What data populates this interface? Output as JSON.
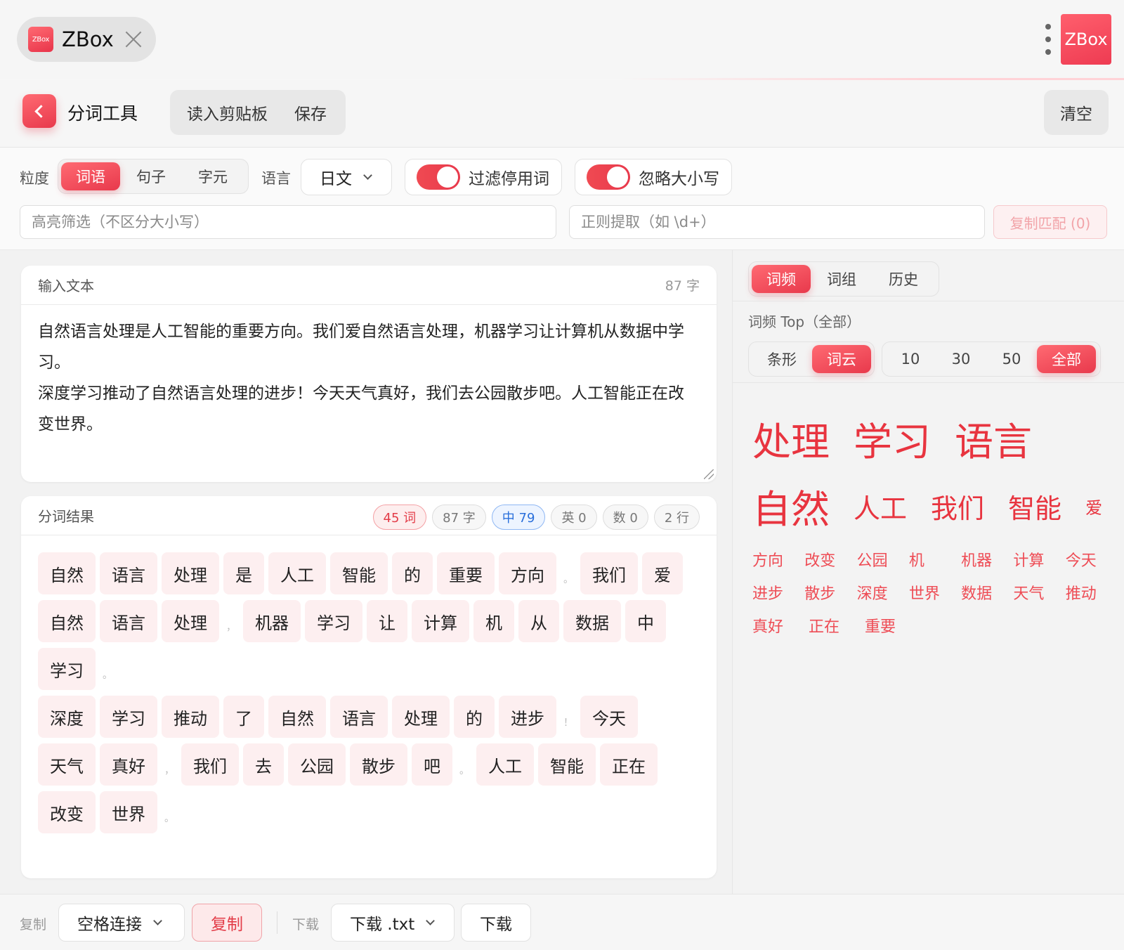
{
  "app": {
    "logo_text": "ZBox",
    "name": "ZBox",
    "brand_text": "ZBox"
  },
  "toolbar": {
    "title": "分词工具",
    "read_clipboard": "读入剪贴板",
    "save": "保存",
    "clear": "清空"
  },
  "options": {
    "granularity_label": "粒度",
    "granularity": [
      "词语",
      "句子",
      "字元"
    ],
    "granularity_selected": "词语",
    "language_label": "语言",
    "language_value": "日文",
    "filter_stopwords": {
      "label": "过滤停用词",
      "on": true
    },
    "ignore_case": {
      "label": "忽略大小写",
      "on": true
    },
    "highlight_placeholder": "高亮筛选（不区分大小写）",
    "regex_placeholder": "正则提取（如 \\d+）",
    "copy_match": "复制匹配 (0)"
  },
  "input": {
    "title": "输入文本",
    "count": "87 字",
    "text": "自然语言处理是人工智能的重要方向。我们爱自然语言处理，机器学习让计算机从数据中学习。\n深度学习推动了自然语言处理的进步！今天天气真好，我们去公园散步吧。人工智能正在改变世界。"
  },
  "result": {
    "title": "分词结果",
    "stats": [
      "45 词",
      "87 字",
      "中 79",
      "英 0",
      "数 0",
      "2 行"
    ],
    "lines": [
      [
        "自然",
        "语言",
        "处理",
        "是",
        "人工",
        "智能",
        "的",
        "重要",
        "方向",
        "。",
        "我们",
        "爱"
      ],
      [
        "自然",
        "语言",
        "处理",
        "，",
        "机器",
        "学习",
        "让",
        "计算",
        "机",
        "从",
        "数据",
        "中"
      ],
      [
        "学习",
        "。"
      ],
      [
        "深度",
        "学习",
        "推动",
        "了",
        "自然",
        "语言",
        "处理",
        "的",
        "进步",
        "！",
        "今天"
      ],
      [
        "天气",
        "真好",
        "，",
        "我们",
        "去",
        "公园",
        "散步",
        "吧",
        "。",
        "人工",
        "智能",
        "正在"
      ],
      [
        "改变",
        "世界",
        "。"
      ]
    ]
  },
  "right": {
    "tabs": [
      "词频",
      "词组",
      "历史"
    ],
    "tab_selected": "词频",
    "freq_title": "词频 Top（全部）",
    "view_modes": [
      "条形",
      "词云"
    ],
    "view_selected": "词云",
    "top_n": [
      "10",
      "30",
      "50",
      "全部"
    ],
    "top_selected": "全部",
    "cloud": {
      "row1": [
        "处理",
        "学习",
        "语言"
      ],
      "row2": [
        "自然",
        "人工",
        "我们",
        "智能",
        "爱"
      ],
      "small": [
        "方向",
        "改变",
        "公园",
        "机",
        "机器",
        "计算",
        "今天",
        "进步",
        "散步",
        "深度",
        "世界",
        "数据",
        "天气",
        "推动",
        "真好",
        "正在",
        "重要"
      ]
    }
  },
  "bottom": {
    "copy_label": "复制",
    "join_mode": "空格连接",
    "copy_button": "复制",
    "download_label": "下载",
    "download_format": "下载 .txt",
    "download_button": "下载"
  }
}
